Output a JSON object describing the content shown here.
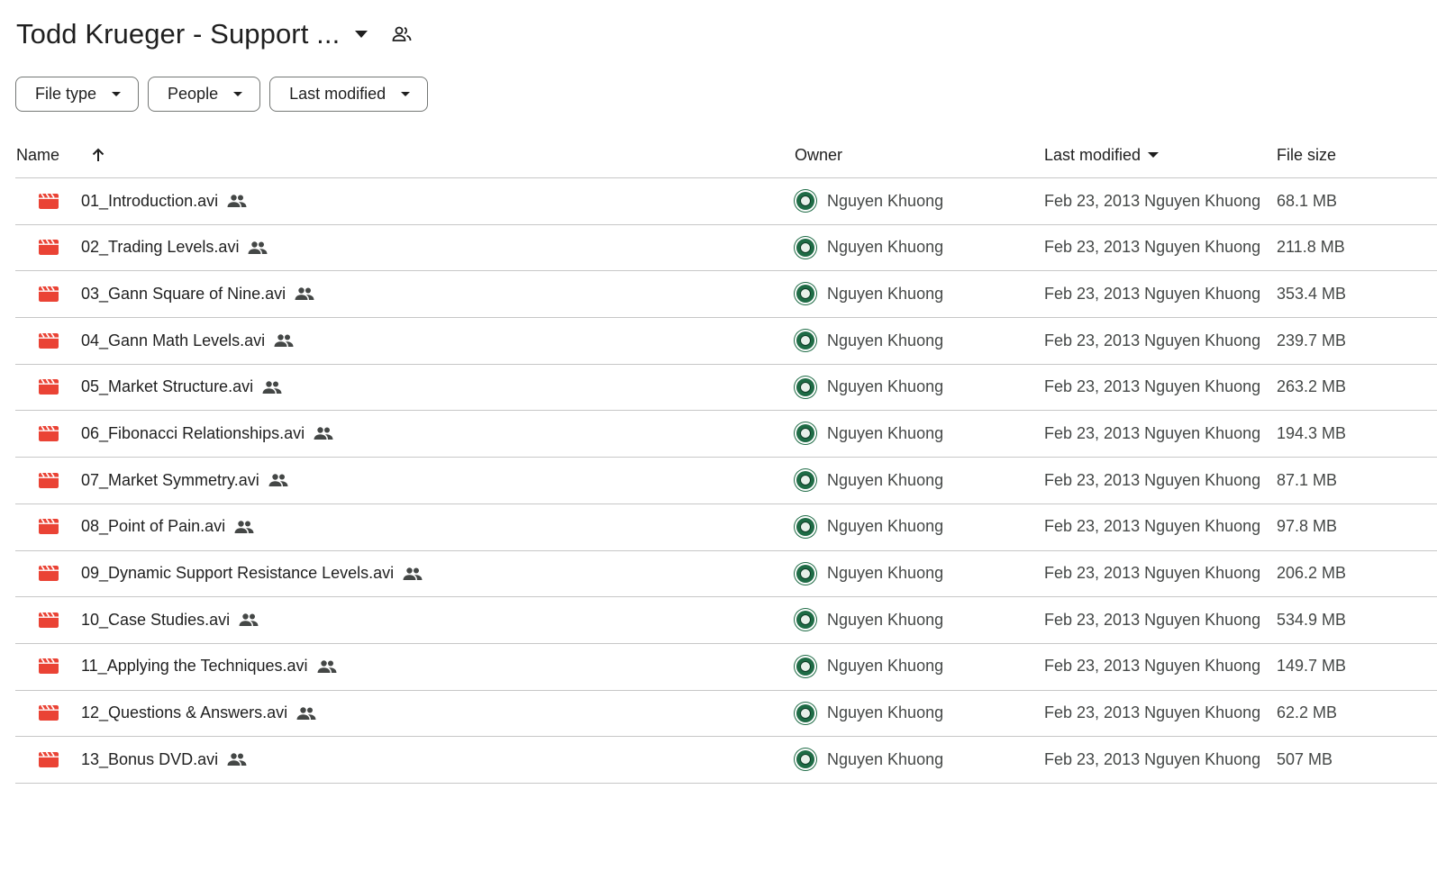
{
  "header": {
    "title": "Todd Krueger - Support ..."
  },
  "filters": [
    {
      "label": "File type"
    },
    {
      "label": "People"
    },
    {
      "label": "Last modified"
    }
  ],
  "table": {
    "columns": {
      "name": "Name",
      "owner": "Owner",
      "last_modified": "Last modified",
      "file_size": "File size"
    },
    "rows": [
      {
        "name": "01_Introduction.avi",
        "owner": "Nguyen Khuong",
        "modified": "Feb 23, 2013 Nguyen Khuong",
        "size": "68.1 MB"
      },
      {
        "name": "02_Trading Levels.avi",
        "owner": "Nguyen Khuong",
        "modified": "Feb 23, 2013 Nguyen Khuong",
        "size": "211.8 MB"
      },
      {
        "name": "03_Gann Square of Nine.avi",
        "owner": "Nguyen Khuong",
        "modified": "Feb 23, 2013 Nguyen Khuong",
        "size": "353.4 MB"
      },
      {
        "name": "04_Gann Math Levels.avi",
        "owner": "Nguyen Khuong",
        "modified": "Feb 23, 2013 Nguyen Khuong",
        "size": "239.7 MB"
      },
      {
        "name": "05_Market Structure.avi",
        "owner": "Nguyen Khuong",
        "modified": "Feb 23, 2013 Nguyen Khuong",
        "size": "263.2 MB"
      },
      {
        "name": "06_Fibonacci Relationships.avi",
        "owner": "Nguyen Khuong",
        "modified": "Feb 23, 2013 Nguyen Khuong",
        "size": "194.3 MB"
      },
      {
        "name": "07_Market Symmetry.avi",
        "owner": "Nguyen Khuong",
        "modified": "Feb 23, 2013 Nguyen Khuong",
        "size": "87.1 MB"
      },
      {
        "name": "08_Point of Pain.avi",
        "owner": "Nguyen Khuong",
        "modified": "Feb 23, 2013 Nguyen Khuong",
        "size": "97.8 MB"
      },
      {
        "name": "09_Dynamic Support Resistance Levels.avi",
        "owner": "Nguyen Khuong",
        "modified": "Feb 23, 2013 Nguyen Khuong",
        "size": "206.2 MB"
      },
      {
        "name": "10_Case Studies.avi",
        "owner": "Nguyen Khuong",
        "modified": "Feb 23, 2013 Nguyen Khuong",
        "size": "534.9 MB"
      },
      {
        "name": "11_Applying the Techniques.avi",
        "owner": "Nguyen Khuong",
        "modified": "Feb 23, 2013 Nguyen Khuong",
        "size": "149.7 MB"
      },
      {
        "name": "12_Questions & Answers.avi",
        "owner": "Nguyen Khuong",
        "modified": "Feb 23, 2013 Nguyen Khuong",
        "size": "62.2 MB"
      },
      {
        "name": "13_Bonus DVD.avi",
        "owner": "Nguyen Khuong",
        "modified": "Feb 23, 2013 Nguyen Khuong",
        "size": "507 MB"
      }
    ]
  },
  "icons": {
    "file": "video-file-icon",
    "shared": "shared-people-icon",
    "sort": "arrow-up-icon",
    "caret": "caret-down-icon"
  },
  "colors": {
    "video_icon": "#ea4335",
    "divider": "#c7c7c7",
    "chip_border": "#747775",
    "avatar": "#1e6b45"
  }
}
